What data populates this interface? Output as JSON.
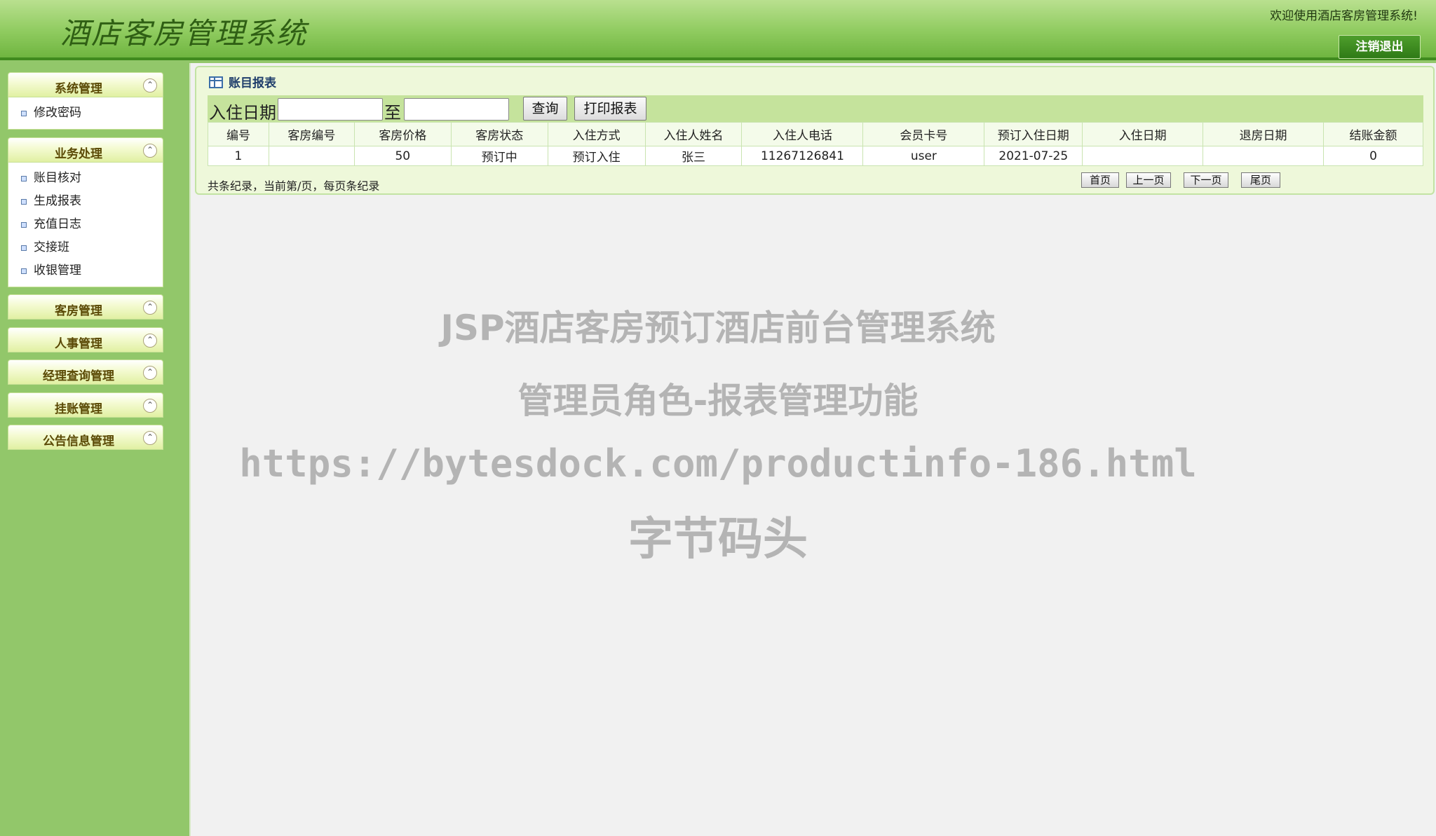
{
  "header": {
    "title": "酒店客房管理系统",
    "welcome": "欢迎使用酒店客房管理系统!",
    "logout_label": "注销退出"
  },
  "sidebar": {
    "groups": [
      {
        "label": "系统管理",
        "items": [
          "修改密码"
        ]
      },
      {
        "label": "业务处理",
        "items": [
          "账目核对",
          "生成报表",
          "充值日志",
          "交接班",
          "收银管理"
        ]
      },
      {
        "label": "客房管理",
        "items": []
      },
      {
        "label": "人事管理",
        "items": []
      },
      {
        "label": "经理查询管理",
        "items": []
      },
      {
        "label": "挂账管理",
        "items": []
      },
      {
        "label": "公告信息管理",
        "items": []
      }
    ]
  },
  "panel": {
    "title": "账目报表",
    "search": {
      "label": "入住日期",
      "to_label": "至",
      "start_value": "",
      "end_value": "",
      "query_label": "查询",
      "print_label": "打印报表"
    },
    "table": {
      "headers": [
        "编号",
        "客房编号",
        "客房价格",
        "客房状态",
        "入住方式",
        "入住人姓名",
        "入住人电话",
        "会员卡号",
        "预订入住日期",
        "入住日期",
        "退房日期",
        "结账金额"
      ],
      "rows": [
        [
          "1",
          "",
          "50",
          "预订中",
          "预订入住",
          "张三",
          "11267126841",
          "user",
          "2021-07-25",
          "",
          "",
          "0"
        ]
      ]
    },
    "records_text": "共条纪录，当前第/页，每页条纪录",
    "pagination": {
      "first": "首页",
      "prev": "上一页",
      "next": "下一页",
      "last": "尾页"
    }
  },
  "watermark": {
    "line1": "JSP酒店客房预订酒店前台管理系统",
    "line2": "管理员角色-报表管理功能",
    "line3": "https://bytesdock.com/productinfo-186.html",
    "line4": "字节码头"
  }
}
